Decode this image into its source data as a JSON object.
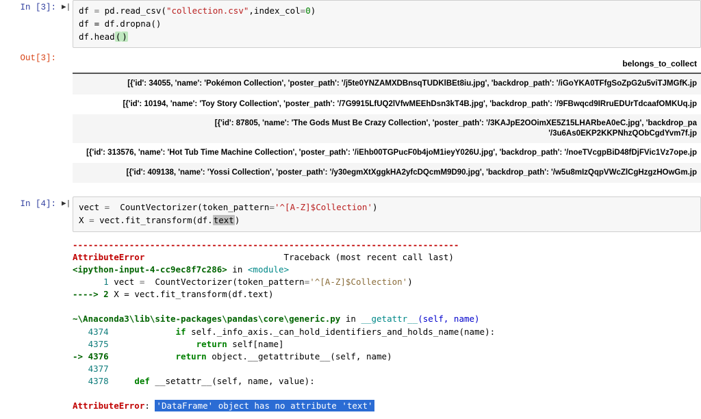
{
  "cells": {
    "in3": {
      "prompt": "In [3]:",
      "code": {
        "l1a": "df ",
        "l1op": "= ",
        "l1b": "pd",
        "l1c": ".read_csv(",
        "l1str": "\"collection.csv\"",
        "l1d": ",index_col",
        "l1op2": "=",
        "l1num": "0",
        "l1e": ")",
        "l2": "df = df.dropna()",
        "l3a": "df",
        "l3b": ".head",
        "l3p1": "(",
        "l3p2": ")"
      }
    },
    "out3": {
      "prompt": "Out[3]:",
      "header": "belongs_to_collect",
      "rows": [
        "[{'id': 34055, 'name': 'Pokémon Collection', 'poster_path': '/j5te0YNZAMXDBnsqTUDKlBEt8iu.jpg', 'backdrop_path': '/iGoYKA0TFfgSoZpG2u5viTJMGfK.jp",
        "[{'id': 10194, 'name': 'Toy Story Collection', 'poster_path': '/7G9915LfUQ2lVfwMEEhDsn3kT4B.jpg', 'backdrop_path': '/9FBwqcd9IRruEDUrTdcaafOMKUq.jp",
        "[{'id': 87805, 'name': 'The Gods Must Be Crazy Collection', 'poster_path': '/3KAJpE2OOimXE5Z15LHARbeA0eC.jpg', 'backdrop_pa\n'/3u6As0EKP2KKPNhzQObCgdYvm7f.jp",
        "[{'id': 313576, 'name': 'Hot Tub Time Machine Collection', 'poster_path': '/iEhb00TGPucF0b4joM1ieyY026U.jpg', 'backdrop_path': '/noeTVcgpBiD48fDjFVic1Vz7ope.jp",
        "[{'id': 409138, 'name': 'Yossi Collection', 'poster_path': '/y30egmXtXggkHA2yfcDQcmM9D90.jpg', 'backdrop_path': '/w5u8mIzQqpVWcZlCgHzgzHOwGm.jp"
      ]
    },
    "in4": {
      "prompt": "In [4]:",
      "code": {
        "l1a": "vect ",
        "l1op": "=  ",
        "l1b": "CountVectorizer(token_pattern",
        "l1op2": "=",
        "l1str": "'^[A-Z]$Collection'",
        "l1c": ")",
        "l2a": "X ",
        "l2op": "= ",
        "l2b": "vect",
        "l2c": ".fit_transform(df.",
        "l2sel": "text",
        "l2d": ")"
      }
    },
    "tb": {
      "dash": "---------------------------------------------------------------------------",
      "err_name": "AttributeError",
      "tb_label": "                           Traceback (most recent call last)",
      "frame1_loc": "<ipython-input-4-cc9ec8f7c286>",
      "frame1_in": " in ",
      "frame1_mod": "<module>",
      "l1_num": "      1",
      "l1_code_a": " vect ",
      "l1_code_b": "=  ",
      "l1_code_c": "CountVectorizer",
      "l1_code_d": "(",
      "l1_code_e": "token_pattern",
      "l1_code_f": "=",
      "l1_code_g": "'^[A-Z]$Collection'",
      "l1_code_h": ")",
      "l2_arrow": "----> 2",
      "l2_code": " X = vect.fit_transform(df.text)",
      "frame2_loc": "~\\Anaconda3\\lib\\site-packages\\pandas\\core\\generic.py",
      "frame2_in": " in ",
      "frame2_fn": "__getattr__",
      "frame2_sig": "(self, name)",
      "f2l1_num": "   4374",
      "f2l1_code_a": "             ",
      "f2l1_code_b": "if",
      "f2l1_code_c": " self._info_axis._can_hold_identifiers_and_holds_name(name):",
      "f2l2_num": "   4375",
      "f2l2_code_a": "                 ",
      "f2l2_code_b": "return",
      "f2l2_code_c": " self[name]",
      "f2l3_arrow": "-> 4376",
      "f2l3_code_a": "             ",
      "f2l3_code_b": "return",
      "f2l3_code_c": " object.__getattribute__(self, name)",
      "f2l4_num": "   4377",
      "f2l5_num": "   4378",
      "f2l5_code_a": "     ",
      "f2l5_code_b": "def",
      "f2l5_code_c": " __setattr__(self, name, value):",
      "final_err": "AttributeError",
      "final_colon": ": ",
      "final_msg": "'DataFrame' object has no attribute 'text'"
    }
  }
}
